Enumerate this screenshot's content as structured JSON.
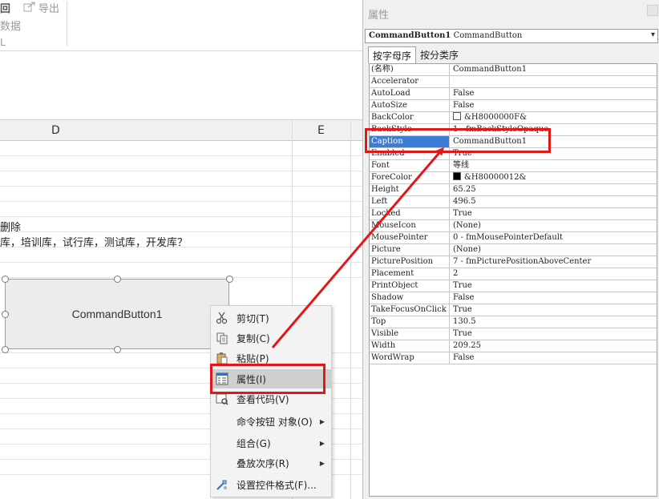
{
  "ribbon": {
    "frag_top_left": "回",
    "export_label": "导出",
    "frag_data": "数据",
    "frag_l": "L"
  },
  "sheet": {
    "columns": [
      "D",
      "E"
    ],
    "cell_line1": "删除",
    "cell_line2": "库，培训库，试行库，测试库，开发库？"
  },
  "command_button": {
    "caption": "CommandButton1"
  },
  "context_menu": {
    "items": [
      {
        "label": "剪切(T)",
        "icon": "scissors-icon"
      },
      {
        "label": "复制(C)",
        "icon": "copy-icon"
      },
      {
        "label": "粘贴(P)",
        "icon": "paste-icon"
      },
      {
        "label": "属性(I)",
        "icon": "properties-icon"
      },
      {
        "label": "查看代码(V)",
        "icon": "view-code-icon"
      },
      {
        "label": "命令按钮 对象(O)",
        "icon": ""
      },
      {
        "label": "组合(G)",
        "icon": ""
      },
      {
        "label": "叠放次序(R)",
        "icon": ""
      },
      {
        "label": "设置控件格式(F)...",
        "icon": "format-control-icon"
      }
    ],
    "highlighted_index": 3
  },
  "properties": {
    "title": "属性",
    "object_name": "CommandButton1",
    "object_type": "CommandButton",
    "tabs": [
      "按字母序",
      "按分类序"
    ],
    "active_tab": 0,
    "rows": [
      {
        "name": "(名称)",
        "value": "CommandButton1"
      },
      {
        "name": "Accelerator",
        "value": ""
      },
      {
        "name": "AutoLoad",
        "value": "False"
      },
      {
        "name": "AutoSize",
        "value": "False"
      },
      {
        "name": "BackColor",
        "value": "&H8000000F&",
        "swatch": "#ffffff"
      },
      {
        "name": "BackStyle",
        "value": "1 - fmBackStyleOpaque"
      },
      {
        "name": "Caption",
        "value": "CommandButton1"
      },
      {
        "name": "Enabled",
        "value": "True"
      },
      {
        "name": "Font",
        "value": "等线"
      },
      {
        "name": "ForeColor",
        "value": "&H80000012&",
        "swatch": "#000000"
      },
      {
        "name": "Height",
        "value": "65.25"
      },
      {
        "name": "Left",
        "value": "496.5"
      },
      {
        "name": "Locked",
        "value": "True"
      },
      {
        "name": "MouseIcon",
        "value": "(None)"
      },
      {
        "name": "MousePointer",
        "value": "0 - fmMousePointerDefault"
      },
      {
        "name": "Picture",
        "value": "(None)"
      },
      {
        "name": "PicturePosition",
        "value": "7 - fmPicturePositionAboveCenter"
      },
      {
        "name": "Placement",
        "value": "2"
      },
      {
        "name": "PrintObject",
        "value": "True"
      },
      {
        "name": "Shadow",
        "value": "False"
      },
      {
        "name": "TakeFocusOnClick",
        "value": "True"
      },
      {
        "name": "Top",
        "value": "130.5"
      },
      {
        "name": "Visible",
        "value": "True"
      },
      {
        "name": "Width",
        "value": "209.25"
      },
      {
        "name": "WordWrap",
        "value": "False"
      }
    ],
    "selected_row": 6
  },
  "colors": {
    "annotation_red": "#e01818",
    "selection_blue": "#3b7cd6",
    "menu_highlight": "#cfcfcf"
  }
}
